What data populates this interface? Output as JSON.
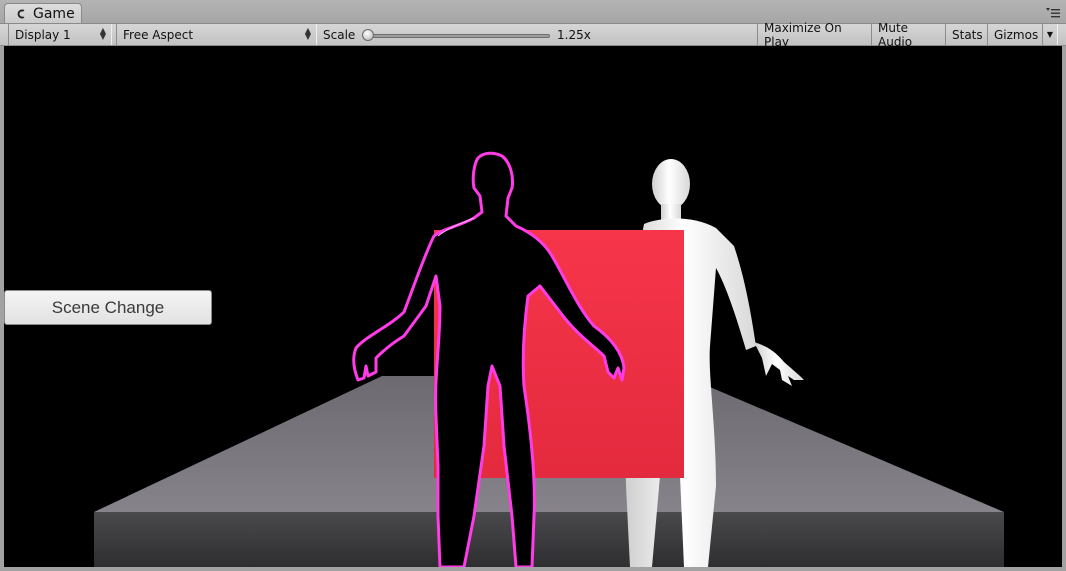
{
  "window": {
    "tab_label": "Game",
    "tab_icon": "unity-game-icon",
    "menu_icon": "panel-menu-icon"
  },
  "toolbar": {
    "display_select": "Display 1",
    "aspect_select": "Free Aspect",
    "scale_label": "Scale",
    "scale_value": "1.25x",
    "maximize_label": "Maximize On Play",
    "mute_label": "Mute Audio",
    "stats_label": "Stats",
    "gizmos_label": "Gizmos"
  },
  "game_view": {
    "scene_change_button": "Scene Change",
    "colors": {
      "background": "#000000",
      "red_panel": "#f03347",
      "outline": "#ff3ce8",
      "floor_top": "#757379",
      "floor_front": "#3c3c3e"
    }
  }
}
